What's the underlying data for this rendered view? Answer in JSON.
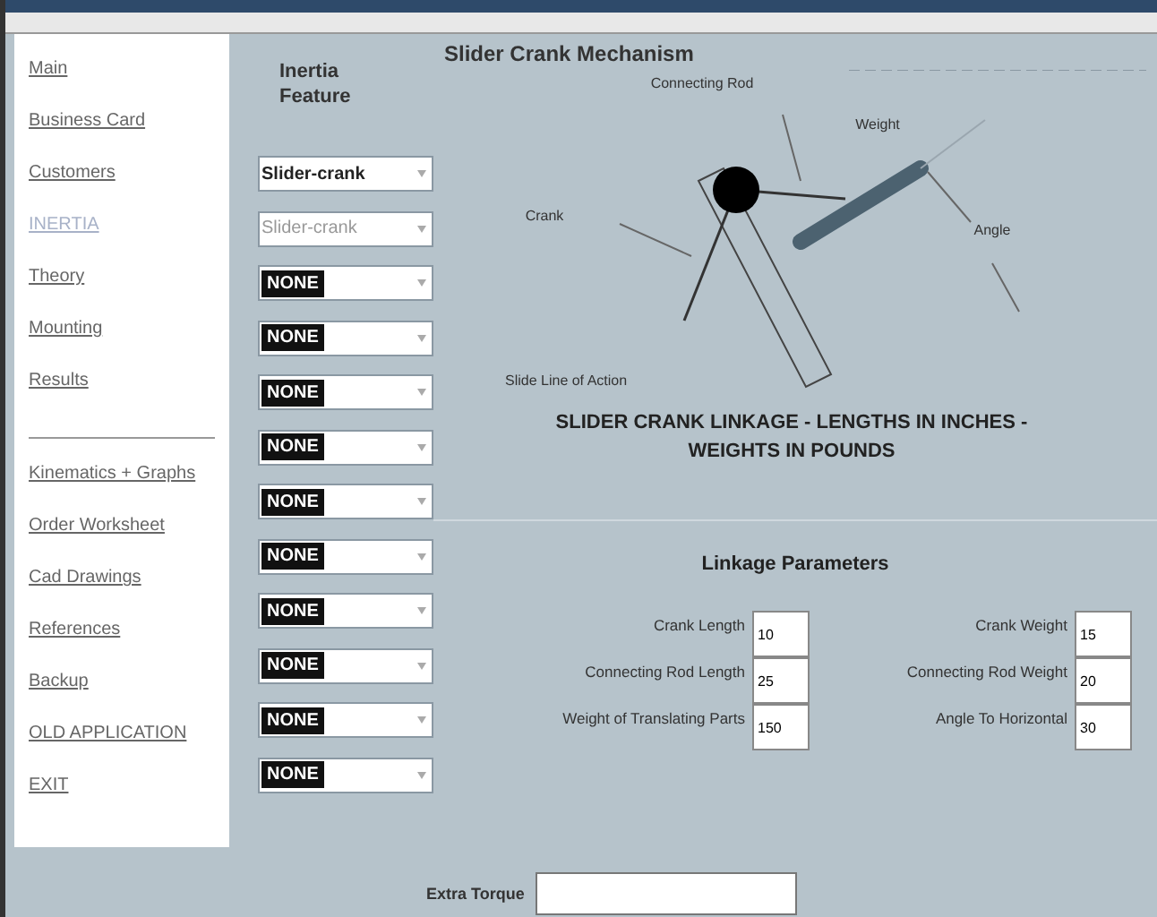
{
  "sidebar": {
    "groups": [
      [
        {
          "label": "Main",
          "selected": false
        },
        {
          "label": "Business Card",
          "selected": false
        },
        {
          "label": "Customers",
          "selected": false
        },
        {
          "label": "INERTIA",
          "selected": true
        },
        {
          "label": "Theory",
          "selected": false
        },
        {
          "label": "Mounting",
          "selected": false
        },
        {
          "label": "Results",
          "selected": false
        }
      ],
      [
        {
          "label": "Kinematics + Graphs",
          "selected": false
        },
        {
          "label": "Order Worksheet",
          "selected": false
        },
        {
          "label": "Cad Drawings",
          "selected": false
        },
        {
          "label": "References",
          "selected": false
        },
        {
          "label": "Backup",
          "selected": false
        },
        {
          "label": "OLD APPLICATION",
          "selected": false
        },
        {
          "label": "EXIT",
          "selected": false
        }
      ]
    ]
  },
  "inertia": {
    "heading": "Inertia Feature",
    "dropdowns": [
      {
        "value": "Slider-crank",
        "highlighted": false,
        "disabled": false
      },
      {
        "value": "Slider-crank",
        "highlighted": false,
        "disabled": true
      },
      {
        "value": "NONE",
        "highlighted": true,
        "disabled": false
      },
      {
        "value": "NONE",
        "highlighted": true,
        "disabled": false
      },
      {
        "value": "NONE",
        "highlighted": true,
        "disabled": false
      },
      {
        "value": "NONE",
        "highlighted": true,
        "disabled": false
      },
      {
        "value": "NONE",
        "highlighted": true,
        "disabled": false
      },
      {
        "value": "NONE",
        "highlighted": true,
        "disabled": false
      },
      {
        "value": "NONE",
        "highlighted": true,
        "disabled": false
      },
      {
        "value": "NONE",
        "highlighted": true,
        "disabled": false
      },
      {
        "value": "NONE",
        "highlighted": true,
        "disabled": false
      },
      {
        "value": "NONE",
        "highlighted": true,
        "disabled": false
      }
    ]
  },
  "mechanism": {
    "title": "Slider Crank Mechanism",
    "labels": [
      "Connecting Rod",
      "Weight",
      "Crank",
      "Angle",
      "Slide Line of Action"
    ],
    "caption": "SLIDER CRANK LINKAGE - LENGTHS IN INCHES - WEIGHTS IN POUNDS"
  },
  "parameters": {
    "title": "Linkage Parameters",
    "fields": [
      {
        "label": "Crank Length",
        "value": "10"
      },
      {
        "label": "Crank Weight",
        "value": "15"
      },
      {
        "label": "Connecting Rod Length",
        "value": "25"
      },
      {
        "label": "Connecting Rod Weight",
        "value": "20"
      },
      {
        "label": "Weight of Translating Parts",
        "value": "150"
      },
      {
        "label": "Angle To Horizontal",
        "value": "30"
      }
    ]
  },
  "extra_torque": {
    "label": "Extra Torque"
  }
}
